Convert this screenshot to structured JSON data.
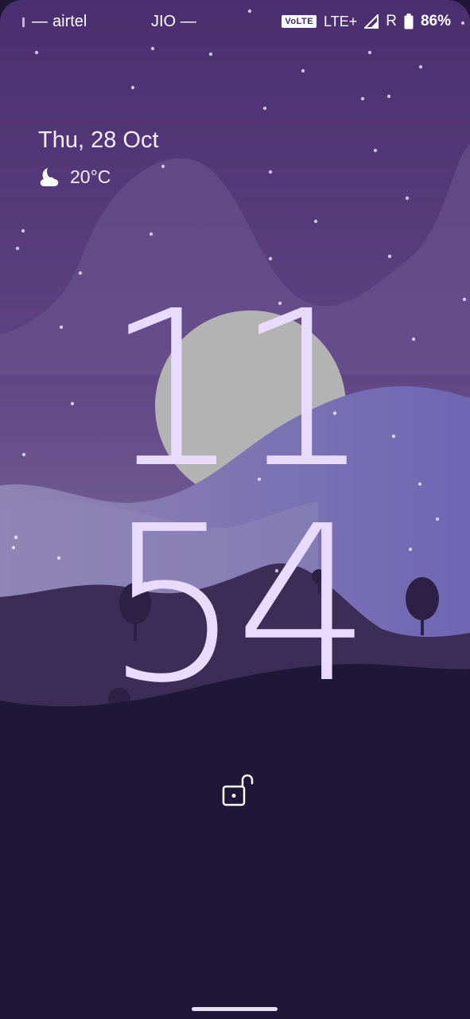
{
  "status_bar": {
    "carrier_1": "airtel",
    "carrier_2": "JIO",
    "volte_badge": "VoLTE",
    "network_type": "LTE+",
    "roaming_indicator": "R",
    "battery_percent": "86%",
    "icons": [
      "signal-icon",
      "volte-icon",
      "cell-signal-icon",
      "battery-icon"
    ]
  },
  "lockscreen": {
    "date": "Thu, 28 Oct",
    "weather": {
      "icon": "moon-cloud-icon",
      "temperature": "20°C"
    },
    "clock": {
      "hours": "11",
      "minutes": "54"
    },
    "lock_icon": "unlocked-padlock-icon"
  },
  "colors": {
    "clock": "#e9dbff",
    "sky_top": "#4b2f6e",
    "sky_mid": "#7a6a9e",
    "hill_far": "#7068b0",
    "hill_dark": "#3a2c52",
    "ground": "#1f1737",
    "moon": "#b3b3b3"
  }
}
